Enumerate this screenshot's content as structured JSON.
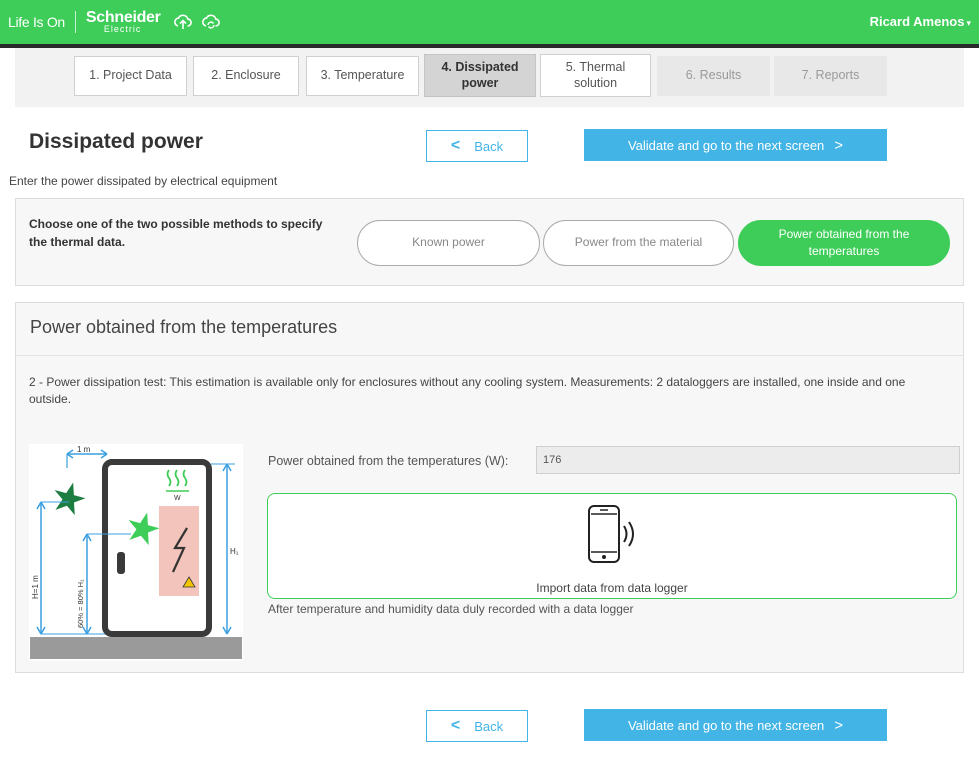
{
  "header": {
    "lifeison": "Life Is On",
    "brand_line1": "Schneider",
    "brand_line2": "Electric",
    "user": "Ricard Amenos",
    "upload_icon": "cloud-upload-icon",
    "sync_icon": "cloud-sync-icon"
  },
  "steps": [
    {
      "label": "1. Project Data",
      "state": "normal"
    },
    {
      "label": "2. Enclosure",
      "state": "normal"
    },
    {
      "label": "3. Temperature",
      "state": "normal"
    },
    {
      "label": "4. Dissipated power",
      "state": "active"
    },
    {
      "label": "5. Thermal solution",
      "state": "normal"
    },
    {
      "label": "6. Results",
      "state": "disabled"
    },
    {
      "label": "7. Reports",
      "state": "disabled"
    }
  ],
  "page": {
    "title": "Dissipated power",
    "subtitle": "Enter the power dissipated by electrical equipment",
    "back_label": "Back",
    "next_label": "Validate and go to the next screen"
  },
  "methods": {
    "prompt": "Choose one of the two possible methods to specify the thermal data.",
    "options": [
      {
        "label": "Known power",
        "selected": false
      },
      {
        "label": "Power from the material",
        "selected": false
      },
      {
        "label": "Power obtained from the temperatures",
        "selected": true
      }
    ]
  },
  "panel": {
    "title": "Power obtained from the temperatures",
    "description": "2 - Power dissipation test: This estimation is available only for enclosures without any cooling system. Measurements: 2 dataloggers are installed, one inside and one outside.",
    "field_label": "Power obtained from the temperatures (W):",
    "field_value": "176",
    "import_label": "Import data from data logger",
    "after_text": "After temperature and humidity data duly recorded with a data logger",
    "diagram": {
      "top_dim": "1 m",
      "outside_height": "H=1 m",
      "inside_height": "60% = 80% H₁",
      "right_height": "H₁",
      "heat_unit": "W"
    }
  },
  "colors": {
    "green": "#3dcd58",
    "blue": "#42b4e6",
    "dark_green_star": "#1e7d40",
    "heater": "#f2c4bb"
  }
}
